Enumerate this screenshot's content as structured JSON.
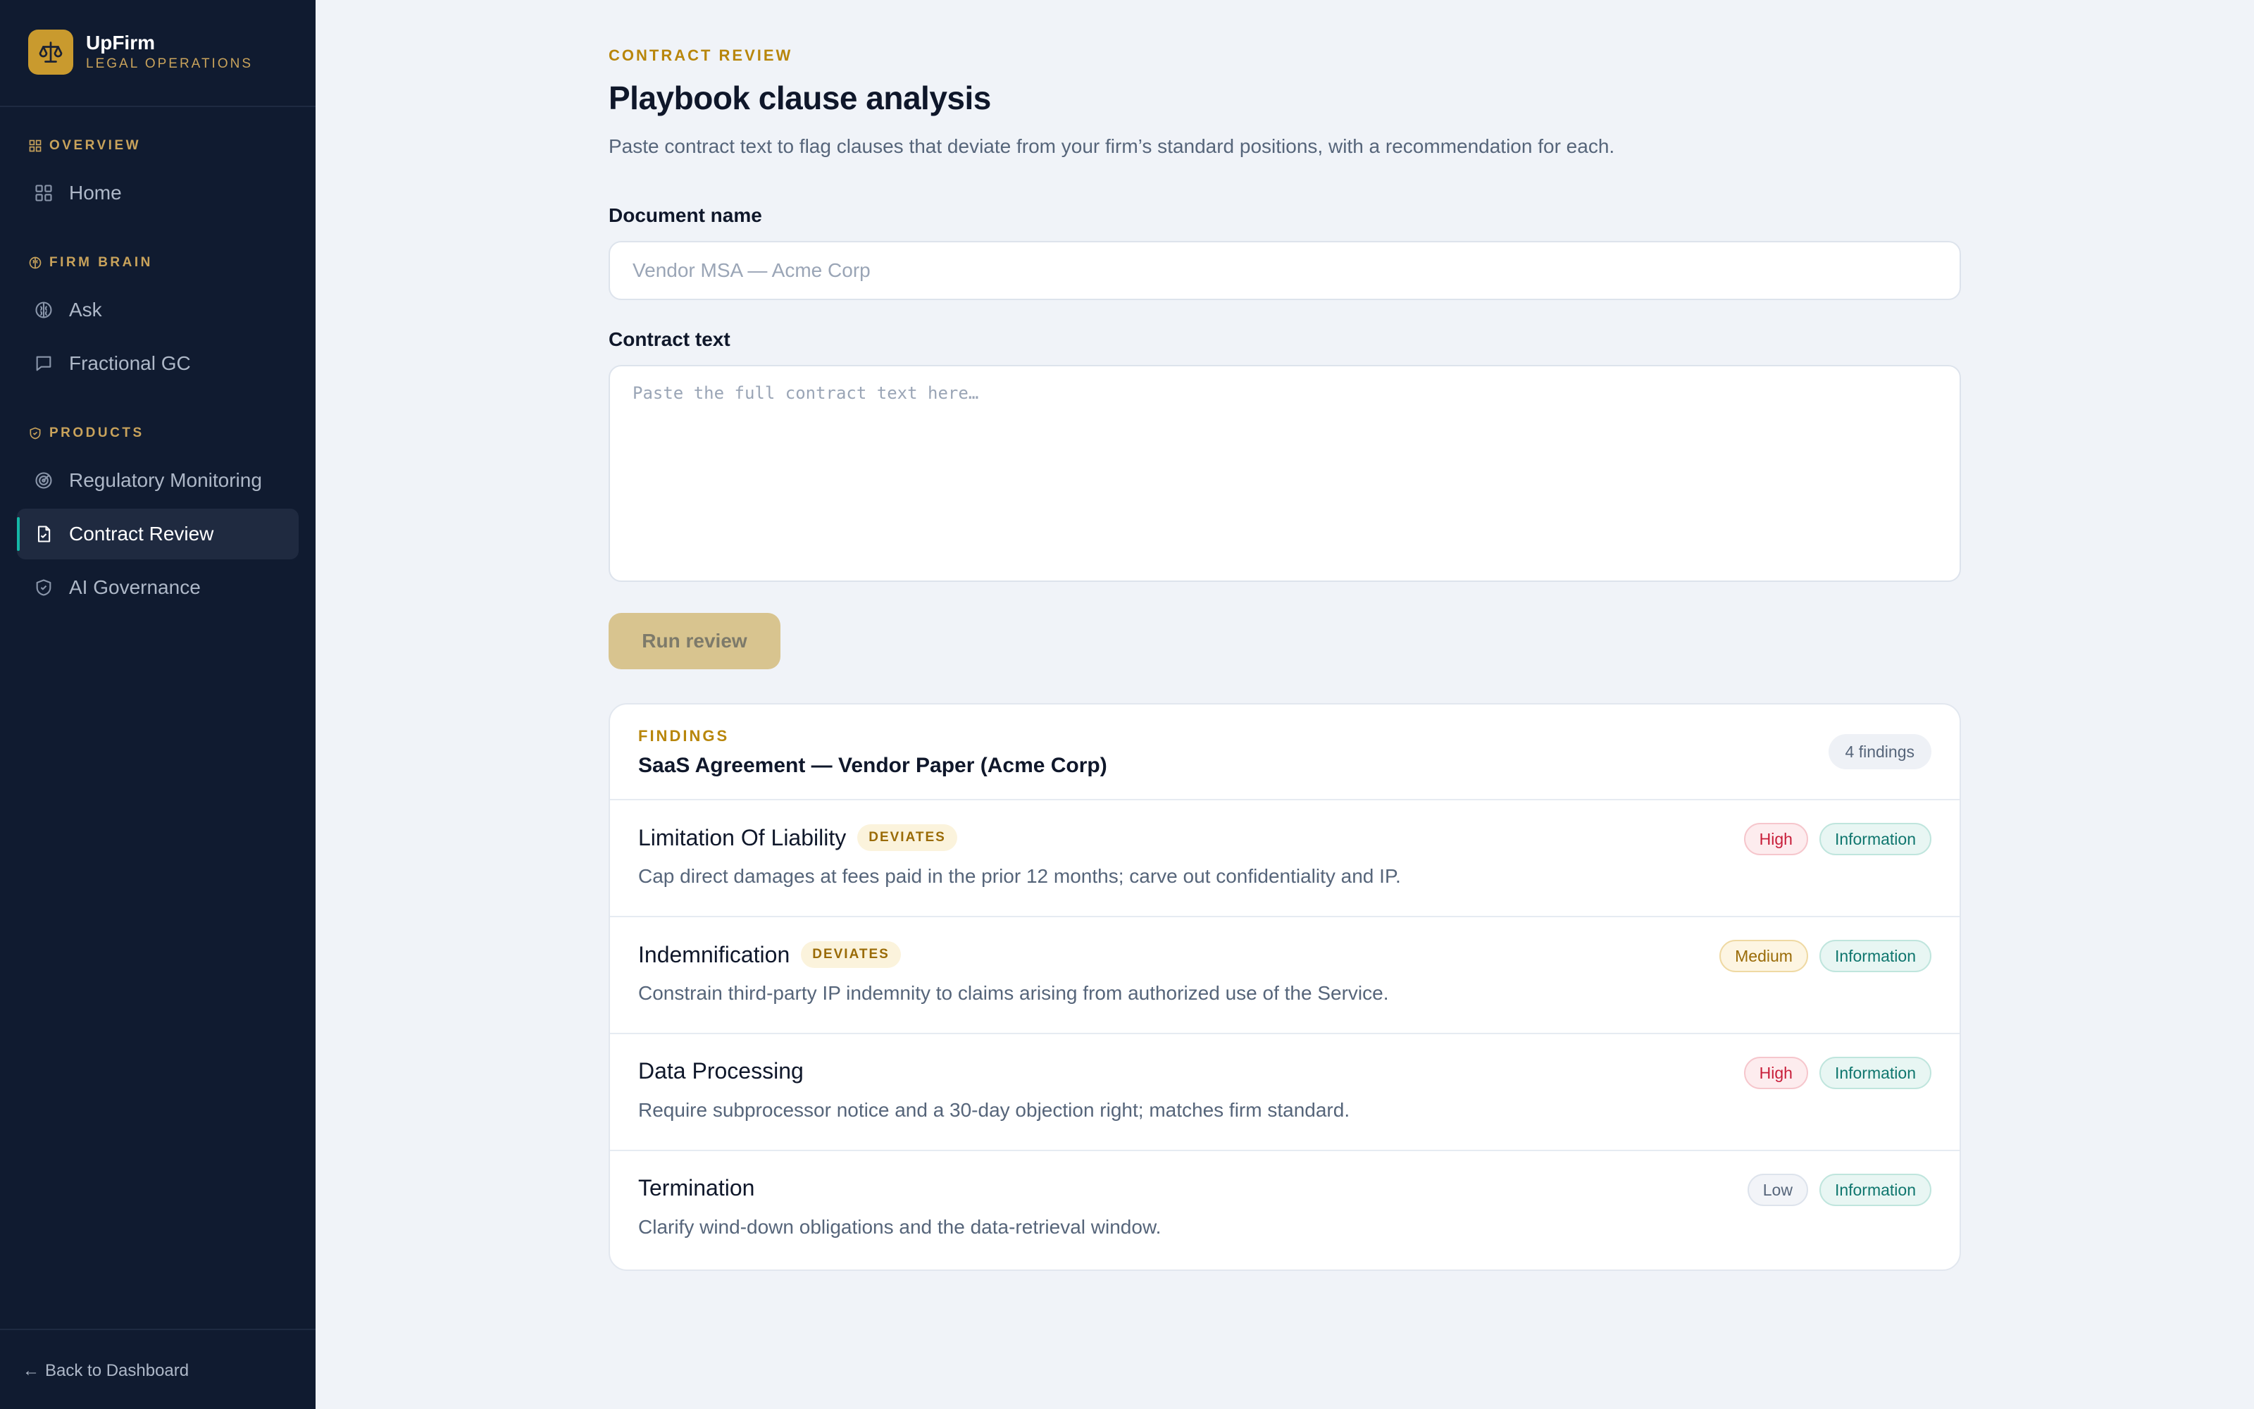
{
  "brand": {
    "name": "UpFirm",
    "subtitle": "LEGAL OPERATIONS"
  },
  "sidebar": {
    "sections": [
      {
        "label": "OVERVIEW",
        "icon": "grid-icon"
      },
      {
        "label": "FIRM BRAIN",
        "icon": "brain-icon"
      },
      {
        "label": "PRODUCTS",
        "icon": "shield-icon"
      }
    ],
    "items": [
      {
        "label": "Home",
        "icon": "grid-icon"
      },
      {
        "label": "Ask",
        "icon": "brain-icon"
      },
      {
        "label": "Fractional GC",
        "icon": "chat-icon"
      },
      {
        "label": "Regulatory Monitoring",
        "icon": "radar-icon"
      },
      {
        "label": "Contract Review",
        "icon": "document-icon",
        "active": true
      },
      {
        "label": "AI Governance",
        "icon": "shield-check-icon"
      }
    ],
    "back_label": "Back to Dashboard"
  },
  "page": {
    "eyebrow": "CONTRACT REVIEW",
    "title": "Playbook clause analysis",
    "description": "Paste contract text to flag clauses that deviate from your firm’s standard positions, with a recommendation for each."
  },
  "form": {
    "document_name_label": "Document name",
    "document_name_value": "",
    "document_name_placeholder": "Vendor MSA — Acme Corp",
    "contract_text_label": "Contract text",
    "contract_text_value": "",
    "contract_text_placeholder": "Paste the full contract text here…",
    "run_label": "Run review"
  },
  "findings": {
    "eyebrow": "FINDINGS",
    "title": "SaaS Agreement — Vendor Paper (Acme Corp)",
    "count_label": "4 findings",
    "items": [
      {
        "title": "Limitation Of Liability",
        "deviates": "DEVIATES",
        "severity": "High",
        "type": "Information",
        "description": "Cap direct damages at fees paid in the prior 12 months; carve out confidentiality and IP."
      },
      {
        "title": "Indemnification",
        "deviates": "DEVIATES",
        "severity": "Medium",
        "type": "Information",
        "description": "Constrain third-party IP indemnity to claims arising from authorized use of the Service."
      },
      {
        "title": "Data Processing",
        "severity": "High",
        "type": "Information",
        "description": "Require subprocessor notice and a 30-day objection right; matches firm standard."
      },
      {
        "title": "Termination",
        "severity": "Low",
        "type": "Information",
        "description": "Clarify wind-down obligations and the data-retrieval window."
      }
    ]
  },
  "colors": {
    "sidebar_bg": "#101b30",
    "accent_gold": "#c99a2e",
    "active_indicator": "#14b8a6",
    "high": "#c81e3a",
    "medium": "#9a6b07",
    "info": "#0f766e"
  }
}
